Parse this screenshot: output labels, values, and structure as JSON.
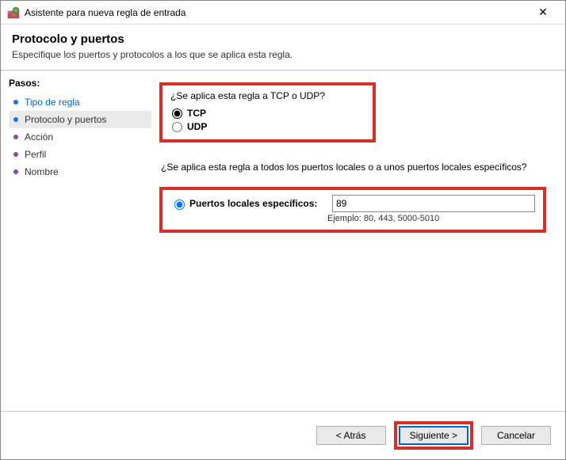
{
  "titlebar": {
    "title": "Asistente para nueva regla de entrada",
    "close_label": "✕"
  },
  "header": {
    "title": "Protocolo y puertos",
    "subtitle": "Especifique los puertos y protocolos a los que se aplica esta regla."
  },
  "sidebar": {
    "heading": "Pasos:",
    "steps": [
      {
        "label": "Tipo de regla"
      },
      {
        "label": "Protocolo y puertos"
      },
      {
        "label": "Acción"
      },
      {
        "label": "Perfil"
      },
      {
        "label": "Nombre"
      }
    ]
  },
  "main": {
    "protocol_question": "¿Se aplica esta regla a TCP o UDP?",
    "tcp_label": "TCP",
    "udp_label": "UDP",
    "ports_question": "¿Se aplica esta regla a todos los puertos locales o a unos puertos locales específicos?",
    "specific_ports_label": "Puertos locales específicos:",
    "port_value": "89",
    "port_example": "Ejemplo: 80, 443, 5000-5010"
  },
  "footer": {
    "back": "< Atrás",
    "next": "Siguiente >",
    "cancel": "Cancelar"
  }
}
